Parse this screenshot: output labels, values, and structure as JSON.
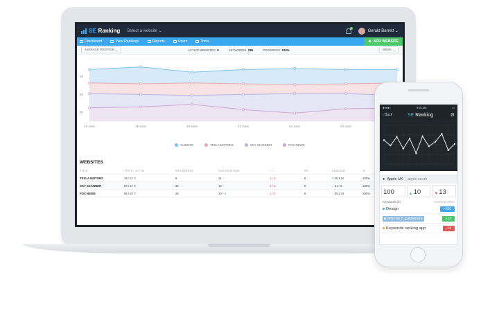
{
  "app": {
    "brand_prefix": "SE",
    "brand_name": "Ranking",
    "site_selector": "Select a website",
    "user_name": "Gerald Barrett"
  },
  "nav": {
    "items": [
      "Dashboard",
      "View Rankings",
      "Reports",
      "Users",
      "Tools"
    ],
    "add_website": "ADD WEBSITE"
  },
  "filters": {
    "position_select": "AVERAGE POSITION",
    "active_websites_label": "ACTIVE WEBSITES:",
    "active_websites_value": "9",
    "keywords_label": "KEYWORDS:",
    "keywords_value": "286",
    "progress_label": "PROGRESS:",
    "progress_value": "100%",
    "period_select": "WEEK"
  },
  "chart_data": {
    "type": "area",
    "categories": [
      "18 June",
      "19 June",
      "20 June",
      "21 June",
      "22 June",
      "23 June",
      "24 June"
    ],
    "y_ticks": [
      "20",
      "40",
      "60"
    ],
    "ylim": [
      70,
      0
    ],
    "grid": true,
    "legend_position": "bottom",
    "series": [
      {
        "name": "CLIENTS",
        "color": "#cfe6f8",
        "line": "#7fc1ee",
        "values": [
          12,
          9,
          15,
          12,
          11,
          12,
          12
        ]
      },
      {
        "name": "TESLA MOTORS",
        "color": "#f6dde0",
        "line": "#e7a7b0",
        "values": [
          27,
          28,
          27,
          28,
          29,
          28,
          27
        ]
      },
      {
        "name": "SKY SCANNER",
        "color": "#e3e2f5",
        "line": "#b4b2e3",
        "values": [
          39,
          40,
          41,
          40,
          39,
          39,
          41
        ]
      },
      {
        "name": "FOX NEWS",
        "color": "#ecdff0",
        "line": "#c9a8d6",
        "values": [
          55,
          54,
          51,
          57,
          61,
          56,
          55
        ]
      }
    ]
  },
  "websites": {
    "title": "WEBSITES",
    "columns": [
      "TITLE",
      "TOP 3 / 10 / 30",
      "KEYWORDS",
      "AVG POSITION",
      "↑ / ↓",
      "PR",
      "INDEXED",
      "%"
    ],
    "rows": [
      {
        "title": "TESLA MOTORS",
        "top": "19 / 2 / 7",
        "keywords": "8",
        "avg": "11",
        "avg_mark": "↑",
        "updown": "1 / 2",
        "pr": "8",
        "indexed": "25.9 M",
        "pct": "100%"
      },
      {
        "title": "SKY SCANNER",
        "top": "84 / 2 / 6",
        "keywords": "26",
        "avg": "12",
        "avg_mark": "•",
        "updown": "5 / 1",
        "pr": "8",
        "indexed": "3.1 M",
        "pct": "100%"
      },
      {
        "title": "FOX NEWS",
        "top": "55 / 5 / 7",
        "keywords": "26",
        "avg": "10",
        "avg_mark": "• 5",
        "updown": "1 / 0",
        "pr": "8",
        "indexed": "35.2 M",
        "pct": "100%"
      }
    ]
  },
  "phone": {
    "time": "9:00 AM",
    "back": "Back",
    "brand_prefix": "SE",
    "brand_name": "Ranking",
    "engine": "Apple UK",
    "domain": "- apple.co.uk",
    "stats": [
      {
        "value": "100",
        "trend": ""
      },
      {
        "value": "10",
        "trend": "up"
      },
      {
        "value": "13",
        "trend": "down"
      }
    ],
    "keywords_label": "Keywords (3)",
    "current_position_label": "current position",
    "keywords": [
      {
        "label": "Design",
        "badge": ">100",
        "badge_color": "#3ea7f0",
        "dot_color": "#3ea7f0"
      },
      {
        "label": "iPhone 5 guidelines",
        "badge": "+12",
        "badge_color": "#4cc86a",
        "dot_color": "#3ea7f0"
      },
      {
        "label": "Keywords ranking app",
        "badge": "-14",
        "badge_color": "#e25555",
        "dot_color": "#e8a14c"
      }
    ],
    "mini_chart": {
      "type": "line",
      "values": [
        62,
        48,
        70,
        40,
        66,
        28,
        72,
        46,
        58,
        78,
        36,
        52
      ],
      "ylim": [
        0,
        100
      ]
    }
  }
}
